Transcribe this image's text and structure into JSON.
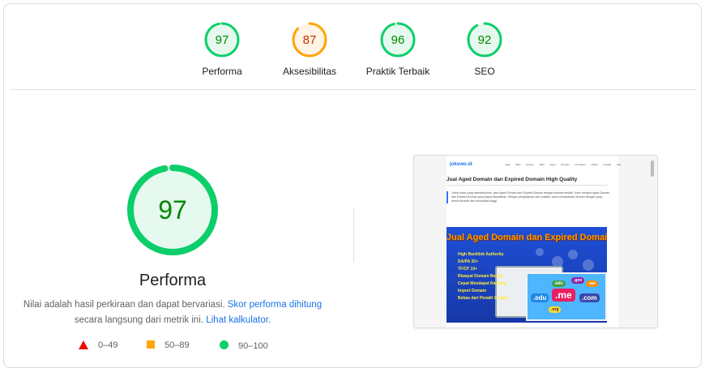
{
  "summary": {
    "gauges": [
      {
        "id": "performance",
        "score": "97",
        "label": "Performa",
        "value": 0.97,
        "color": "#0cce6b",
        "text_color": "#008800",
        "bg": "#e6f9ee"
      },
      {
        "id": "accessibility",
        "score": "87",
        "label": "Aksesibilitas",
        "value": 0.87,
        "color": "#ffa400",
        "text_color": "#c33300",
        "bg": "#fff4e5"
      },
      {
        "id": "best-practices",
        "score": "96",
        "label": "Praktik Terbaik",
        "value": 0.96,
        "color": "#0cce6b",
        "text_color": "#008800",
        "bg": "#e6f9ee"
      },
      {
        "id": "seo",
        "score": "92",
        "label": "SEO",
        "value": 0.92,
        "color": "#0cce6b",
        "text_color": "#008800",
        "bg": "#e6f9ee"
      }
    ]
  },
  "detail": {
    "score": "97",
    "value": 0.97,
    "title": "Performa",
    "desc_prefix": "Nilai adalah hasil perkiraan dan dapat bervariasi. ",
    "desc_link1": "Skor performa dihitung",
    "desc_middle": " secara langsung dari metrik ini. ",
    "desc_link2": "Lihat kalkulator",
    "desc_suffix": ".",
    "legend": {
      "fail": "0–49",
      "average": "50–89",
      "pass": "90–100"
    }
  },
  "screenshot": {
    "logo": "jokowo.id",
    "nav": "Jasa SEO  Kursus SEO  Aged Domain  Penulisan Artikel  Google Ads",
    "page_title": "Jual Aged Domain dan Expired Domain High Quality",
    "quote": "Untuk Anda yang membutuhkan Jasa Aged Domain dan Expired Domain dengan kualitas terbaik. Kami menjual Aged Domain dan Expired Domain yang dapat diandalkan. Dengan pengalaman dan kualitas, kami menawarkan domain dengan yang bersih terbukti dan berkualitas tinggi.",
    "banner_title": "Jual Aged Domain dan Expired Domain",
    "bullets": [
      "High Backlink Authority",
      "DA/PA 30+",
      "TF/CF 10+",
      "Riwayat Domain Bersih",
      "Cepat Mendapat Ranking",
      "Import Domain",
      "Bebas dari Penalti Google"
    ],
    "tlds": [
      ".gov",
      ".info",
      ".net",
      ".edu",
      ".me",
      ".com",
      ".org"
    ]
  }
}
